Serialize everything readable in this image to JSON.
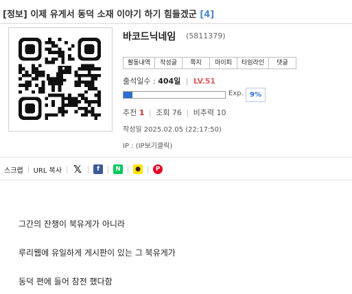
{
  "post": {
    "title": "[정보] 이제 유게서 동덕 소재 이야기 하기 힘들겠군",
    "comment_count": "[4]"
  },
  "author": {
    "nickname": "바코드닉네임",
    "uid": "(5811379)",
    "buttons": [
      "활동내역",
      "작성글",
      "쪽지",
      "마이피",
      "타임라인",
      "댓글"
    ],
    "attendance_label": "출석일수 :",
    "attendance_value": "404일",
    "level": "LV.51",
    "exp_label": "Exp.",
    "exp_percent": "9%",
    "exp_fraction": 0.09
  },
  "stats": {
    "recommend_label": "추천",
    "recommend_value": "1",
    "views_label": "조회",
    "views_value": "76",
    "nonrecommend_label": "비추력",
    "nonrecommend_value": "10"
  },
  "meta": {
    "date": "작성일 2025.02.05 (22:17:50)",
    "ip": "IP : (IP보기클릭)"
  },
  "share": {
    "scrap": "스크랩",
    "url_copy": "URL 복사",
    "x_glyph": "𝕏",
    "facebook_glyph": "f",
    "naver_glyph": "N",
    "kakao_glyph": "●",
    "pinterest_glyph": "P"
  },
  "content": {
    "lines": [
      "그간의 잔챙이 북유게가 아니라",
      "루리웹에 유일하게 게시판이 있는 그 북유게가",
      "동덕 편에 들어 참전 했다함"
    ]
  },
  "icons": {
    "qr_code": "qr-code-icon",
    "dino": "dinosaur-icon"
  },
  "colors": {
    "accent_blue": "#2c6fd0",
    "level_red": "#e05a5a",
    "recommend_red": "#d02b2b",
    "count_blue": "#4a86c8"
  }
}
